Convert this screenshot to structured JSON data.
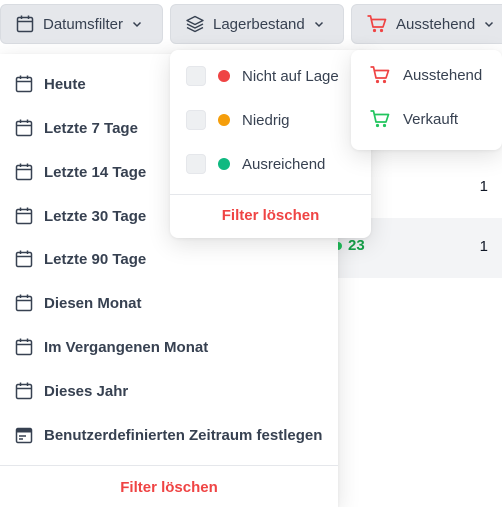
{
  "toolbar": {
    "date_label": "Datumsfilter",
    "stock_label": "Lagerbestand",
    "status_label": "Ausstehend"
  },
  "background_table": {
    "row1_value": "1",
    "row2_badge": "23",
    "row2_value": "1"
  },
  "date_filter": {
    "items": [
      "Heute",
      "Letzte 7 Tage",
      "Letzte 14 Tage",
      "Letzte 30 Tage",
      "Letzte 90 Tage",
      "Diesen Monat",
      "Im Vergangenen Monat",
      "Dieses Jahr",
      "Benutzerdefinierten Zeitraum festlegen"
    ],
    "clear_label": "Filter löschen"
  },
  "stock_filter": {
    "items": [
      {
        "label": "Nicht auf Lage",
        "color": "#ef4444"
      },
      {
        "label": "Niedrig",
        "color": "#f59e0b"
      },
      {
        "label": "Ausreichend",
        "color": "#10b981"
      }
    ],
    "clear_label": "Filter löschen"
  },
  "status_filter": {
    "items": [
      {
        "label": "Ausstehend",
        "icon": "cart-icon",
        "color": "#ef4444"
      },
      {
        "label": "Verkauft",
        "icon": "cart-icon",
        "color": "#22c55e"
      }
    ]
  },
  "colors": {
    "accent_red": "#ef4444",
    "button_bg": "#e5e7eb"
  }
}
